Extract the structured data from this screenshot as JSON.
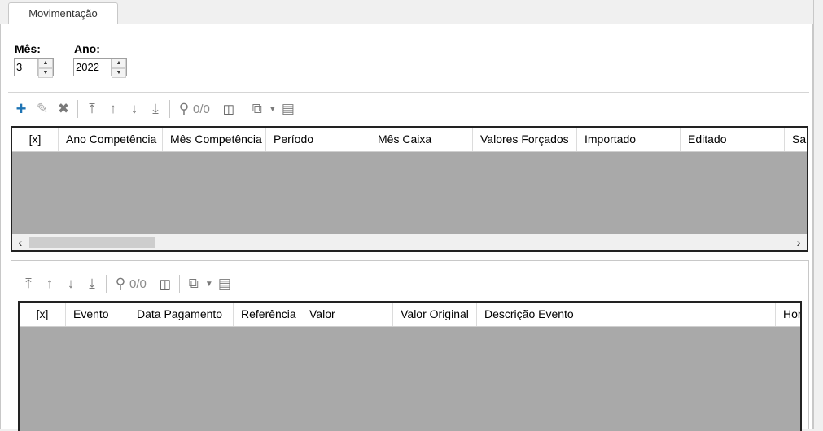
{
  "tab": {
    "label": "Movimentação"
  },
  "filters": {
    "mes_label": "Mês:",
    "mes_value": "3",
    "ano_label": "Ano:",
    "ano_value": "2022"
  },
  "toolbar1": {
    "count": "0/0"
  },
  "grid1": {
    "columns": [
      "[x]",
      "Ano Competência",
      "Mês Competência",
      "Período",
      "Mês Caixa",
      "Valores Forçados",
      "Importado",
      "Editado",
      "Sala"
    ]
  },
  "toolbar2": {
    "count": "0/0"
  },
  "grid2": {
    "columns": [
      "[x]",
      "Evento",
      "Data Pagamento",
      "Referência",
      "Valor",
      "Valor Original",
      "Descrição Evento",
      "Hora"
    ]
  },
  "icons": {
    "add": "plus-icon",
    "edit": "pencil-icon",
    "delete": "x-icon",
    "first": "arrow-first-icon",
    "up": "arrow-up-icon",
    "down": "arrow-down-icon",
    "last": "arrow-last-icon",
    "search": "search-icon",
    "columns": "columns-icon",
    "export": "export-icon",
    "report": "report-icon"
  },
  "colors": {
    "accent": "#1e74b4",
    "grid_empty": "#a9a9a9"
  }
}
